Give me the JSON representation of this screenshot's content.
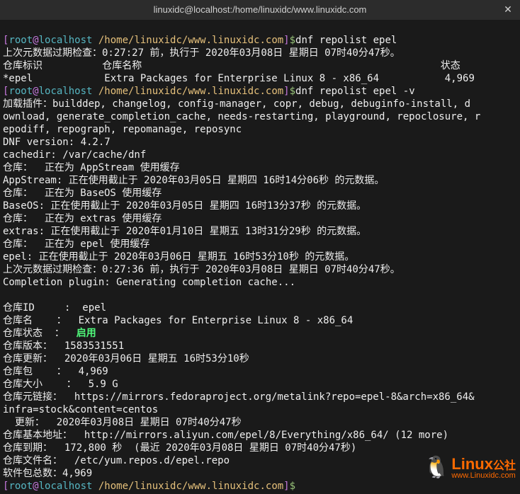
{
  "title": "linuxidc@localhost:/home/linuxidc/www.linuxidc.com",
  "prompt": {
    "open": "[",
    "user": "root",
    "at": "@",
    "host": "localhost",
    "path": " /home/linuxidc/www.linuxidc.com",
    "close": "]",
    "hash": "$"
  },
  "cmd1": "dnf repolist epel",
  "l2": "上次元数据过期检查：0:27:27 前，执行于 2020年03月08日 星期日 07时40分47秒。",
  "l3a": "仓库标识          仓库名称                                                  状态",
  "l4a": "*epel            Extra Packages for Enterprise Linux 8 - x86_64           4,969",
  "cmd2": "dnf repolist epel -v",
  "l6": "加载插件：builddep, changelog, config-manager, copr, debug, debuginfo-install, d",
  "l7": "ownload, generate_completion_cache, needs-restarting, playground, repoclosure, r",
  "l8": "epodiff, repograph, repomanage, reposync",
  "l9": "DNF version: 4.2.7",
  "l10": "cachedir: /var/cache/dnf",
  "l11": "仓库：  正在为 AppStream 使用缓存",
  "l12": "AppStream: 正在使用截止于 2020年03月05日 星期四 16时14分06秒 的元数据。",
  "l13": "仓库：  正在为 BaseOS 使用缓存",
  "l14": "BaseOS: 正在使用截止于 2020年03月05日 星期四 16时13分37秒 的元数据。",
  "l15": "仓库：  正在为 extras 使用缓存",
  "l16": "extras: 正在使用截止于 2020年01月10日 星期五 13时31分29秒 的元数据。",
  "l17": "仓库：  正在为 epel 使用缓存",
  "l18": "epel: 正在使用截止于 2020年03月06日 星期五 16时53分10秒 的元数据。",
  "l19": "上次元数据过期检查：0:27:36 前，执行于 2020年03月08日 星期日 07时40分47秒。",
  "l20": "Completion plugin: Generating completion cache...",
  "l21": "",
  "l22": "仓库ID     :  epel",
  "l23": "仓库名    ：  Extra Packages for Enterprise Linux 8 - x86_64",
  "l24a": "仓库状态  ：  ",
  "l24b": "启用",
  "l25": "仓库版本：  1583531551",
  "l26": "仓库更新：  2020年03月06日 星期五 16时53分10秒",
  "l27": "仓库包    ：  4,969",
  "l28": "仓库大小    ：  5.9 G",
  "l29": "仓库元链接：  https://mirrors.fedoraproject.org/metalink?repo=epel-8&arch=x86_64&",
  "l30": "infra=stock&content=centos",
  "l31": "  更新：  2020年03月08日 星期日 07时40分47秒",
  "l32": "仓库基本地址：  http://mirrors.aliyun.com/epel/8/Everything/x86_64/ (12 more)",
  "l33": "仓库到期：  172,800 秒  (最近 2020年03月08日 星期日 07时40分47秒)",
  "l34": "仓库文件名：  /etc/yum.repos.d/epel.repo",
  "l35": "软件包总数：4,969",
  "watermark": {
    "main": "Linux",
    "sub1": "公社",
    "sub2": "www.Linuxidc.com"
  }
}
